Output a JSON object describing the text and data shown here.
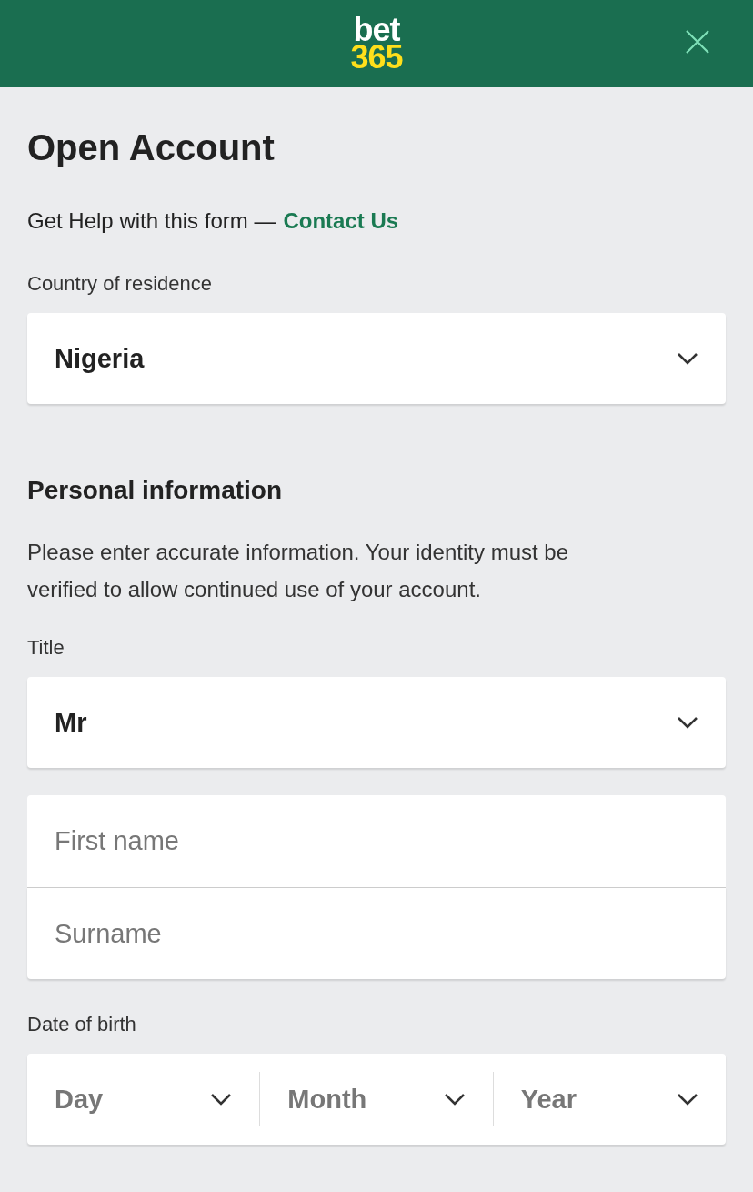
{
  "header": {
    "logo": {
      "line_1": "bet",
      "line_2": "365"
    }
  },
  "title": "Open Account",
  "help": {
    "text": "Get Help with this form —",
    "link": "Contact Us"
  },
  "country": {
    "label": "Country of residence",
    "value": "Nigeria"
  },
  "section": {
    "title": "Personal information",
    "description": "Please enter accurate information. Your identity must be verified to allow continued use of your account."
  },
  "title_field": {
    "label": "Title",
    "value": "Mr"
  },
  "name_fields": [
    {
      "placeholder": "First name"
    },
    {
      "placeholder": "Surname"
    }
  ],
  "date_of_birth": {
    "label": "Date of birth",
    "parts": [
      {
        "placeholder": "Day"
      },
      {
        "placeholder": "Month"
      },
      {
        "placeholder": "Year"
      }
    ]
  }
}
